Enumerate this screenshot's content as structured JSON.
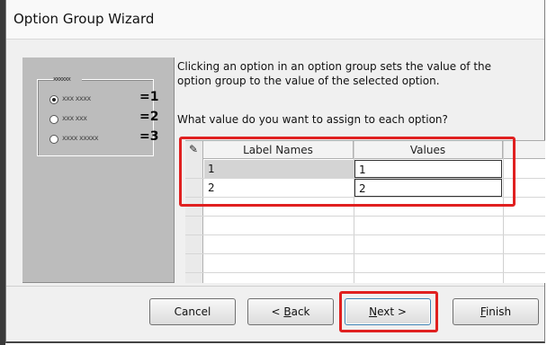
{
  "window": {
    "title": "Option Group Wizard"
  },
  "illustration": {
    "legend": "xxxxxx",
    "options": [
      {
        "text": "xxx xxxx",
        "value": "=1",
        "selected": true
      },
      {
        "text": "xxx xxx",
        "value": "=2",
        "selected": false
      },
      {
        "text": "xxxx xxxxx",
        "value": "=3",
        "selected": false
      }
    ]
  },
  "description": {
    "line1": "Clicking an option in an option group sets the value of the",
    "line2": "option group to the value of the selected option.",
    "question": "What value do you want to assign to each option?"
  },
  "grid": {
    "headers": {
      "label_names": "Label Names",
      "values": "Values"
    },
    "rows": [
      {
        "label": "1",
        "value": "1"
      },
      {
        "label": "2",
        "value": "2"
      }
    ]
  },
  "buttons": {
    "cancel": "Cancel",
    "back": {
      "prefix": "< ",
      "mnemonic": "B",
      "rest": "ack"
    },
    "next": {
      "mnemonic": "N",
      "rest": "ext >"
    },
    "finish": {
      "mnemonic": "F",
      "rest": "inish"
    }
  },
  "colors": {
    "highlight": "#e02020",
    "illustration_bg": "#bcbcbc"
  }
}
